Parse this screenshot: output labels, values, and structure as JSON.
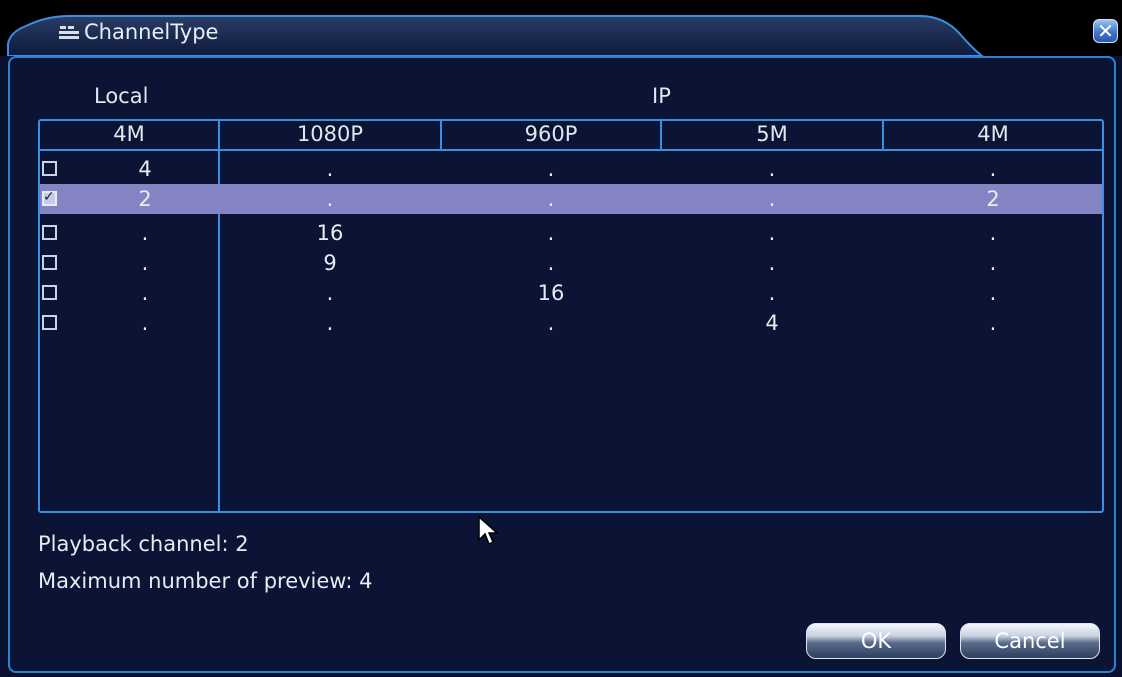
{
  "window": {
    "title": "ChannelType",
    "close_icon": "close-icon",
    "accent": "#3b8fe0",
    "selected_row_color": "#8483c3"
  },
  "table": {
    "group_local": "Local",
    "group_ip": "IP",
    "columns": [
      "4M",
      "1080P",
      "960P",
      "5M",
      "4M"
    ],
    "rows": [
      {
        "checked": false,
        "cells": [
          "4",
          ".",
          ".",
          ".",
          "."
        ]
      },
      {
        "checked": true,
        "cells": [
          "2",
          ".",
          ".",
          ".",
          "2"
        ]
      },
      {
        "checked": false,
        "cells": [
          ".",
          "16",
          ".",
          ".",
          "."
        ]
      },
      {
        "checked": false,
        "cells": [
          ".",
          "9",
          ".",
          ".",
          "."
        ]
      },
      {
        "checked": false,
        "cells": [
          ".",
          ".",
          "16",
          ".",
          "."
        ]
      },
      {
        "checked": false,
        "cells": [
          ".",
          ".",
          ".",
          "4",
          "."
        ]
      }
    ]
  },
  "info": {
    "playback": "Playback channel: 2",
    "preview": "Maximum number of preview: 4"
  },
  "buttons": {
    "ok": "OK",
    "cancel": "Cancel"
  }
}
